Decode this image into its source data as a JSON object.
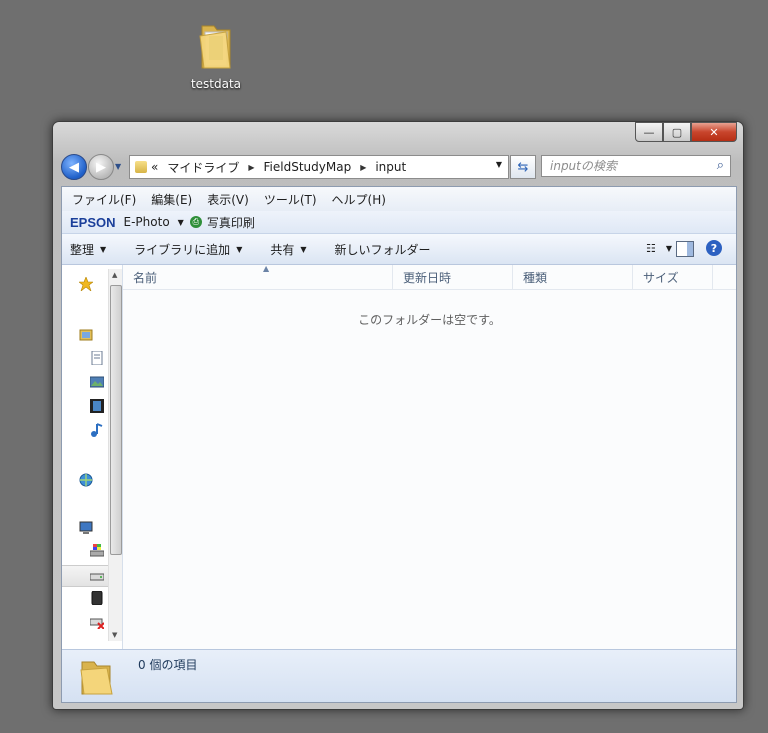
{
  "desktop": {
    "icon_label": "testdata"
  },
  "window": {
    "caption_buttons": {
      "minimize": "—",
      "maximize": "▢",
      "close": "✕"
    },
    "address": {
      "crumbs": [
        "マイドライブ",
        "FieldStudyMap",
        "input"
      ],
      "chevron": "«"
    },
    "search": {
      "placeholder": "inputの検索"
    },
    "menu": [
      "ファイル(F)",
      "編集(E)",
      "表示(V)",
      "ツール(T)",
      "ヘルプ(H)"
    ],
    "epson": {
      "logo": "EPSON",
      "app": "E-Photo",
      "print": "写真印刷"
    },
    "commands": {
      "organize": "整理",
      "add_library": "ライブラリに追加",
      "share": "共有",
      "new_folder": "新しいフォルダー"
    },
    "columns": [
      "名前",
      "更新日時",
      "種類",
      "サイズ"
    ],
    "empty_message": "このフォルダーは空です。",
    "status": {
      "count_text": "0 個の項目"
    }
  },
  "colors": {
    "desktop": "#6f6f6f",
    "accent": "#2d61c1"
  }
}
